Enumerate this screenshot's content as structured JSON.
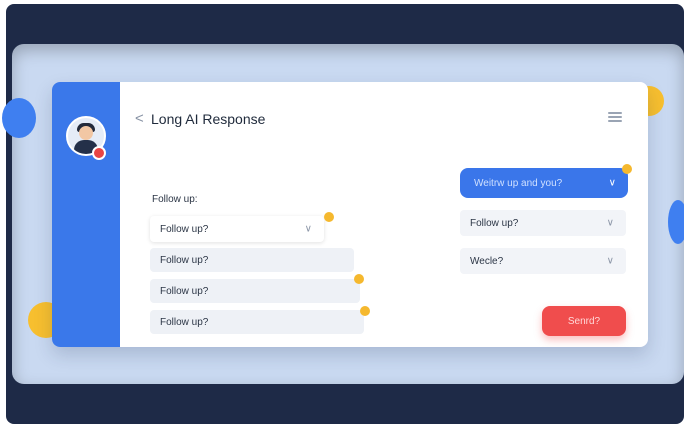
{
  "app": {
    "title": "Long AI Response",
    "back_glyph": "<",
    "menu_icon": "hamburger-menu-icon"
  },
  "user": {
    "avatar_icon": "user-avatar-icon",
    "status_color": "#e84545"
  },
  "form": {
    "section_label": "Follow up:",
    "left_fields": [
      {
        "value": "Follow up?",
        "has_dropdown": true
      },
      {
        "value": "Follow up?"
      },
      {
        "value": "Follow up?"
      },
      {
        "value": "Follow up?"
      }
    ],
    "right_pill": {
      "value": "Weitrw up and you?",
      "has_dropdown": true
    },
    "right_fields": [
      {
        "value": "Follow up?",
        "has_dropdown": true
      },
      {
        "value": "Wecle?",
        "has_dropdown": true
      }
    ],
    "submit_label": "Senrd?"
  },
  "colors": {
    "accent_blue": "#3a78ea",
    "submit_red": "#f04d4d",
    "marker_yellow": "#f5b82e",
    "background_navy": "#1e2a47"
  }
}
